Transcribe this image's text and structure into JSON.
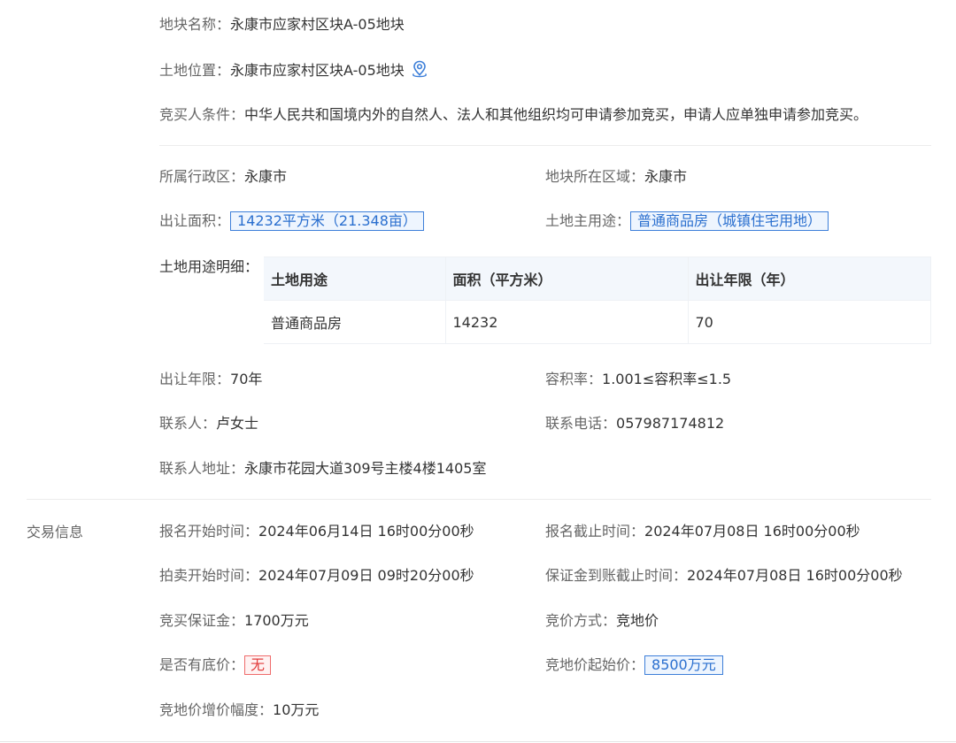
{
  "plot": {
    "name_label": "地块名称：",
    "name_value": "永康市应家村区块A-05地块",
    "location_label": "土地位置：",
    "location_value": "永康市应家村区块A-05地块",
    "location_icon": "map-pin-icon",
    "bidder_label": "竞买人条件：",
    "bidder_value": "中华人民共和国境内外的自然人、法人和其他组织均可申请参加竞买，申请人应单独申请参加竞买。",
    "district_label": "所属行政区：",
    "district_value": "永康市",
    "region_label": "地块所在区域：",
    "region_value": "永康市",
    "area_label": "出让面积：",
    "area_value": "14232平方米（21.348亩）",
    "use_label": "土地主用途：",
    "use_value": "普通商品房（城镇住宅用地）",
    "use_detail_label": "土地用途明细：",
    "table": {
      "headers": [
        "土地用途",
        "面积（平方米）",
        "出让年限（年）"
      ],
      "rows": [
        [
          "普通商品房",
          "14232",
          "70"
        ]
      ]
    },
    "term_label": "出让年限：",
    "term_value": "70年",
    "far_label": "容积率：",
    "far_value": "1.001≤容积率≤1.5",
    "contact_label": "联系人：",
    "contact_value": "卢女士",
    "phone_label": "联系电话：",
    "phone_value": "057987174812",
    "address_label": "联系人地址：",
    "address_value": "永康市花园大道309号主楼4楼1405室"
  },
  "trade": {
    "section_title": "交易信息",
    "reg_start_label": "报名开始时间：",
    "reg_start_value": "2024年06月14日 16时00分00秒",
    "reg_end_label": "报名截止时间：",
    "reg_end_value": "2024年07月08日 16时00分00秒",
    "auction_start_label": "拍卖开始时间：",
    "auction_start_value": "2024年07月09日 09时20分00秒",
    "deposit_deadline_label": "保证金到账截止时间：",
    "deposit_deadline_value": "2024年07月08日 16时00分00秒",
    "deposit_label": "竞买保证金：",
    "deposit_value": "1700万元",
    "bid_method_label": "竞价方式：",
    "bid_method_value": "竞地价",
    "reserve_label": "是否有底价：",
    "reserve_value": "无",
    "start_price_label": "竞地价起始价：",
    "start_price_value": "8500万元",
    "increment_label": "竞地价增价幅度：",
    "increment_value": "10万元"
  },
  "colors": {
    "tag_blue": "#2a6fcf",
    "tag_red": "#e23b3b",
    "table_header_bg": "#f3f7fc"
  }
}
